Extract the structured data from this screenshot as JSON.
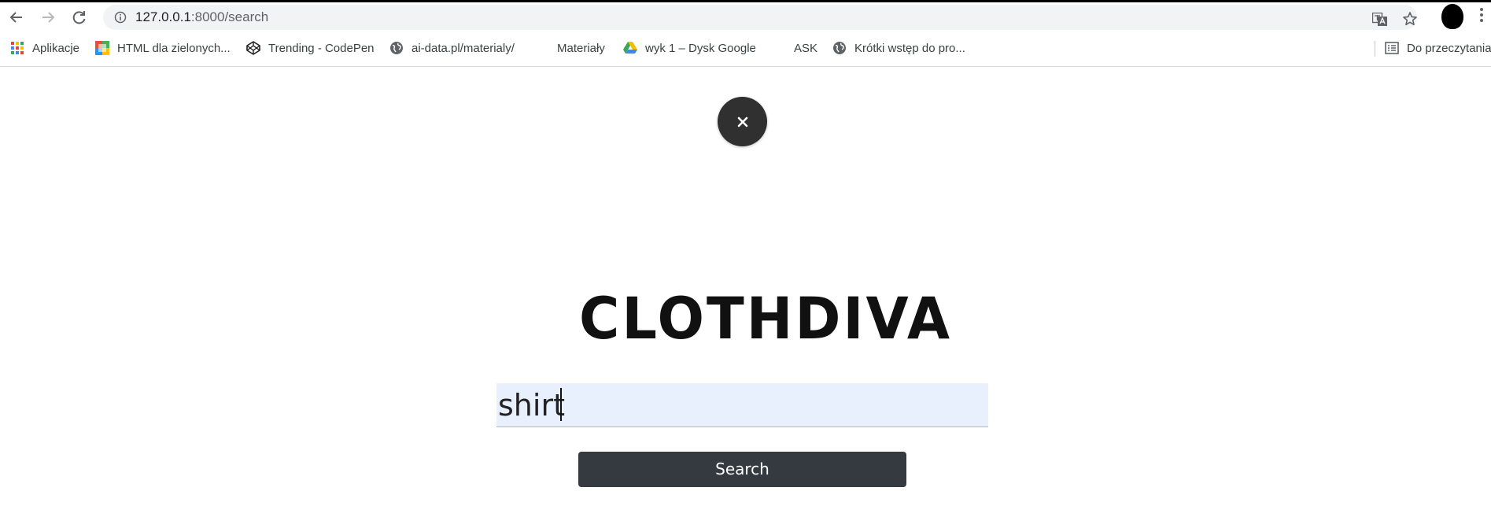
{
  "browser": {
    "url_host": "127.0.0.1",
    "url_path": ":8000/search",
    "bookmarks": [
      {
        "label": "Aplikacje",
        "icon": "apps-grid-icon"
      },
      {
        "label": "HTML dla zielonych...",
        "icon": "html-book-icon"
      },
      {
        "label": "Trending - CodePen",
        "icon": "codepen-icon"
      },
      {
        "label": "ai-data.pl/materialy/",
        "icon": "globe-icon"
      },
      {
        "label": "Materiały",
        "icon": "blank-icon"
      },
      {
        "label": "wyk 1 – Dysk Google",
        "icon": "google-drive-icon"
      },
      {
        "label": "ASK",
        "icon": "blank-icon"
      },
      {
        "label": "Krótki wstęp do pro...",
        "icon": "globe-icon"
      },
      {
        "label": "Do przeczytania",
        "icon": "reading-list-icon"
      }
    ]
  },
  "page": {
    "close_symbol": "×",
    "logo_text": "CLOTHDIVA",
    "search_value": "shirt",
    "search_button_label": "Search"
  }
}
